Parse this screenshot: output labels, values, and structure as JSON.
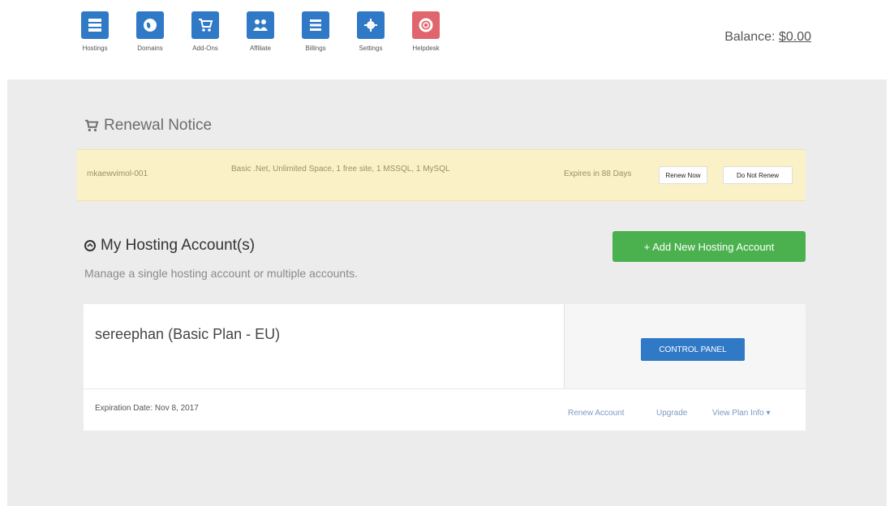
{
  "nav": {
    "items": [
      {
        "label": "Hostings",
        "icon": "server-icon"
      },
      {
        "label": "Domains",
        "icon": "globe-icon"
      },
      {
        "label": "Add-Ons",
        "icon": "cart-icon"
      },
      {
        "label": "Affiliate",
        "icon": "users-icon"
      },
      {
        "label": "Billings",
        "icon": "list-icon"
      },
      {
        "label": "Settings",
        "icon": "gear-icon"
      },
      {
        "label": "Helpdesk",
        "icon": "lifebuoy-icon"
      }
    ]
  },
  "balance": {
    "label": "Balance:",
    "amount": "$0.00"
  },
  "renewal": {
    "title": "Renewal Notice",
    "account": "mkaewvimol-001",
    "description": "Basic .Net, Unlimited Space, 1 free site, 1 MSSQL, 1 MySQL",
    "expires": "Expires in 88 Days",
    "renew_now": "Renew Now",
    "do_not_renew": "Do Not Renew"
  },
  "hosting": {
    "title": "My Hosting Account(s)",
    "subtitle": "Manage a single hosting account or multiple accounts.",
    "add_button": "+ Add New Hosting Account",
    "account": {
      "name": "sereephan (Basic Plan - EU)",
      "control_panel": "CONTROL PANEL",
      "expiration": "Expiration Date: Nov 8, 2017",
      "renew": "Renew Account",
      "upgrade": "Upgrade",
      "view_plan": "View Plan Info ▾"
    }
  },
  "colors": {
    "primary": "#2f79c7",
    "success": "#4bb14f",
    "helpdesk": "#e0656d",
    "notice_bg": "#fbf1c7"
  }
}
